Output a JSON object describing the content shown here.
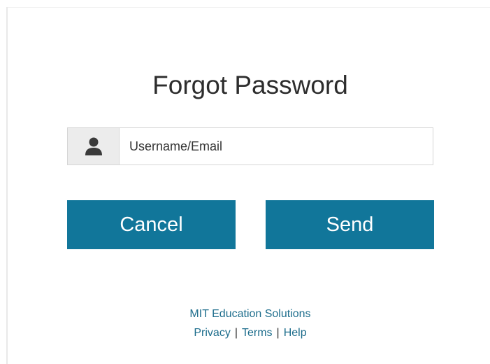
{
  "page": {
    "title": "Forgot Password"
  },
  "form": {
    "username_placeholder": "Username/Email",
    "username_value": "",
    "user_icon": "user-icon"
  },
  "actions": {
    "cancel_label": "Cancel",
    "send_label": "Send"
  },
  "footer": {
    "org_name": "MIT Education Solutions",
    "links": [
      "Privacy",
      "Terms",
      "Help"
    ],
    "separator": "|"
  },
  "colors": {
    "button_bg": "#11769a",
    "link": "#1d6d8c",
    "addon_bg": "#ececec"
  }
}
